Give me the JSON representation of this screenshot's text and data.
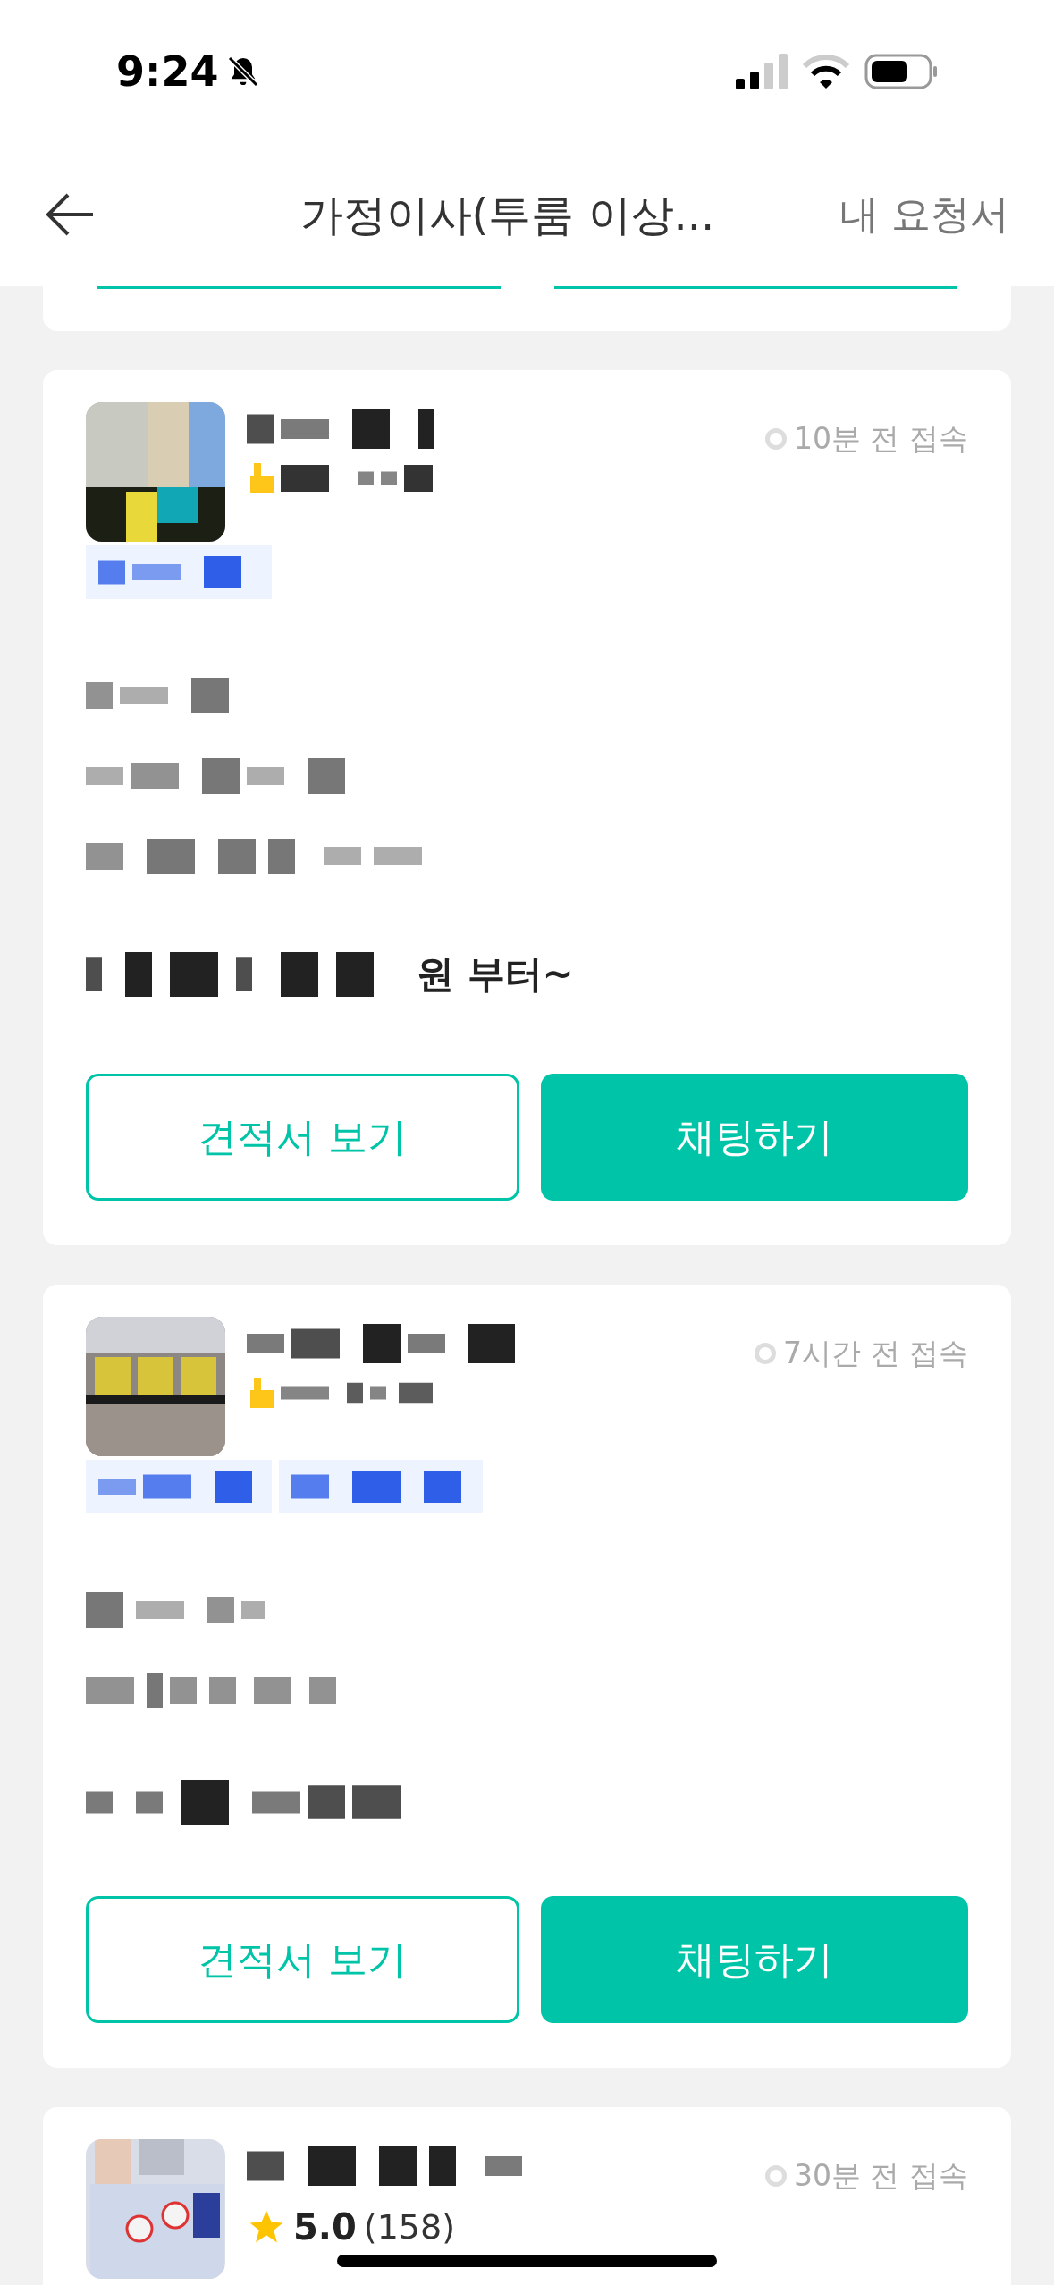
{
  "status_bar": {
    "time": "9:24",
    "silent": true
  },
  "header": {
    "title": "가정이사(투룸 이상...",
    "action": "내 요청서"
  },
  "previous_card": {
    "kind": "partial"
  },
  "cards": [
    {
      "kind": "full",
      "avatar": {
        "kind": "picture"
      },
      "last_seen": "10분 전 접속",
      "tags": [
        {
          "kind": "hidden"
        }
      ],
      "details": [
        {
          "kind": "hidden"
        },
        {
          "kind": "hidden"
        },
        {
          "kind": "hidden"
        }
      ],
      "price_suffix": "원 부터~",
      "buttons": [
        {
          "label": "견적서 보기",
          "kind": "outline"
        },
        {
          "label": "채팅하기",
          "kind": "solid"
        }
      ]
    },
    {
      "kind": "full",
      "avatar": {
        "kind": "picture"
      },
      "last_seen": "7시간 전 접속",
      "tags": [
        {
          "kind": "hidden"
        },
        {
          "kind": "hidden"
        }
      ],
      "details": [
        {
          "kind": "hidden"
        },
        {
          "kind": "hidden"
        }
      ],
      "buttons": [
        {
          "label": "견적서 보기",
          "kind": "outline"
        },
        {
          "label": "채팅하기",
          "kind": "solid"
        }
      ]
    },
    {
      "kind": "partial",
      "avatar": {
        "kind": "picture"
      },
      "last_seen": "30분 전 접속",
      "rating": "5.0",
      "reviews": "(158)"
    }
  ]
}
